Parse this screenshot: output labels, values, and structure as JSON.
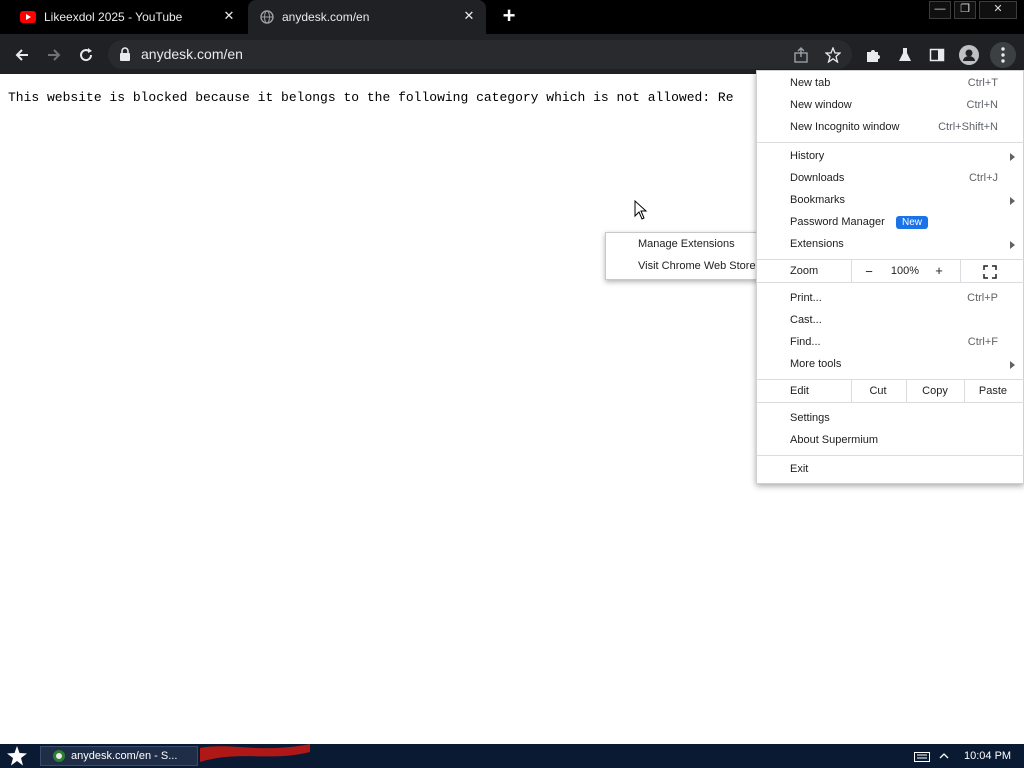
{
  "tabs": [
    {
      "title": "Likeexdol 2025 - YouTube",
      "icon": "youtube-icon",
      "close": "✕"
    },
    {
      "title": "anydesk.com/en",
      "icon": "globe-icon",
      "close": "✕"
    }
  ],
  "new_tab_glyph": "+",
  "window_controls": {
    "minimize": "—",
    "restore": "❐",
    "close": "✕"
  },
  "toolbar": {
    "url": "anydesk.com/en"
  },
  "page": {
    "message": "This website is blocked because it belongs to the following category which is not allowed: Re"
  },
  "menu": {
    "new_tab": {
      "label": "New tab",
      "shortcut": "Ctrl+T"
    },
    "new_window": {
      "label": "New window",
      "shortcut": "Ctrl+N"
    },
    "new_incognito": {
      "label": "New Incognito window",
      "shortcut": "Ctrl+Shift+N"
    },
    "history": {
      "label": "History"
    },
    "downloads": {
      "label": "Downloads",
      "shortcut": "Ctrl+J"
    },
    "bookmarks": {
      "label": "Bookmarks"
    },
    "password_manager": {
      "label": "Password Manager",
      "badge": "New"
    },
    "extensions": {
      "label": "Extensions"
    },
    "zoom": {
      "label": "Zoom",
      "minus": "−",
      "value": "100%",
      "plus": "+"
    },
    "print": {
      "label": "Print...",
      "shortcut": "Ctrl+P"
    },
    "cast": {
      "label": "Cast..."
    },
    "find": {
      "label": "Find...",
      "shortcut": "Ctrl+F"
    },
    "more_tools": {
      "label": "More tools"
    },
    "edit": {
      "label": "Edit",
      "cut": "Cut",
      "copy": "Copy",
      "paste": "Paste"
    },
    "settings": {
      "label": "Settings"
    },
    "about": {
      "label": "About Supermium"
    },
    "exit": {
      "label": "Exit"
    }
  },
  "submenu": {
    "manage_extensions": "Manage Extensions",
    "visit_store": "Visit Chrome Web Store"
  },
  "taskbar": {
    "window_label": "anydesk.com/en - S...",
    "clock": "10:04 PM"
  },
  "colors": {
    "tabstrip": "#000000",
    "toolbar": "#202124",
    "badge": "#1a73e8",
    "taskbar": "#0b1a33"
  }
}
